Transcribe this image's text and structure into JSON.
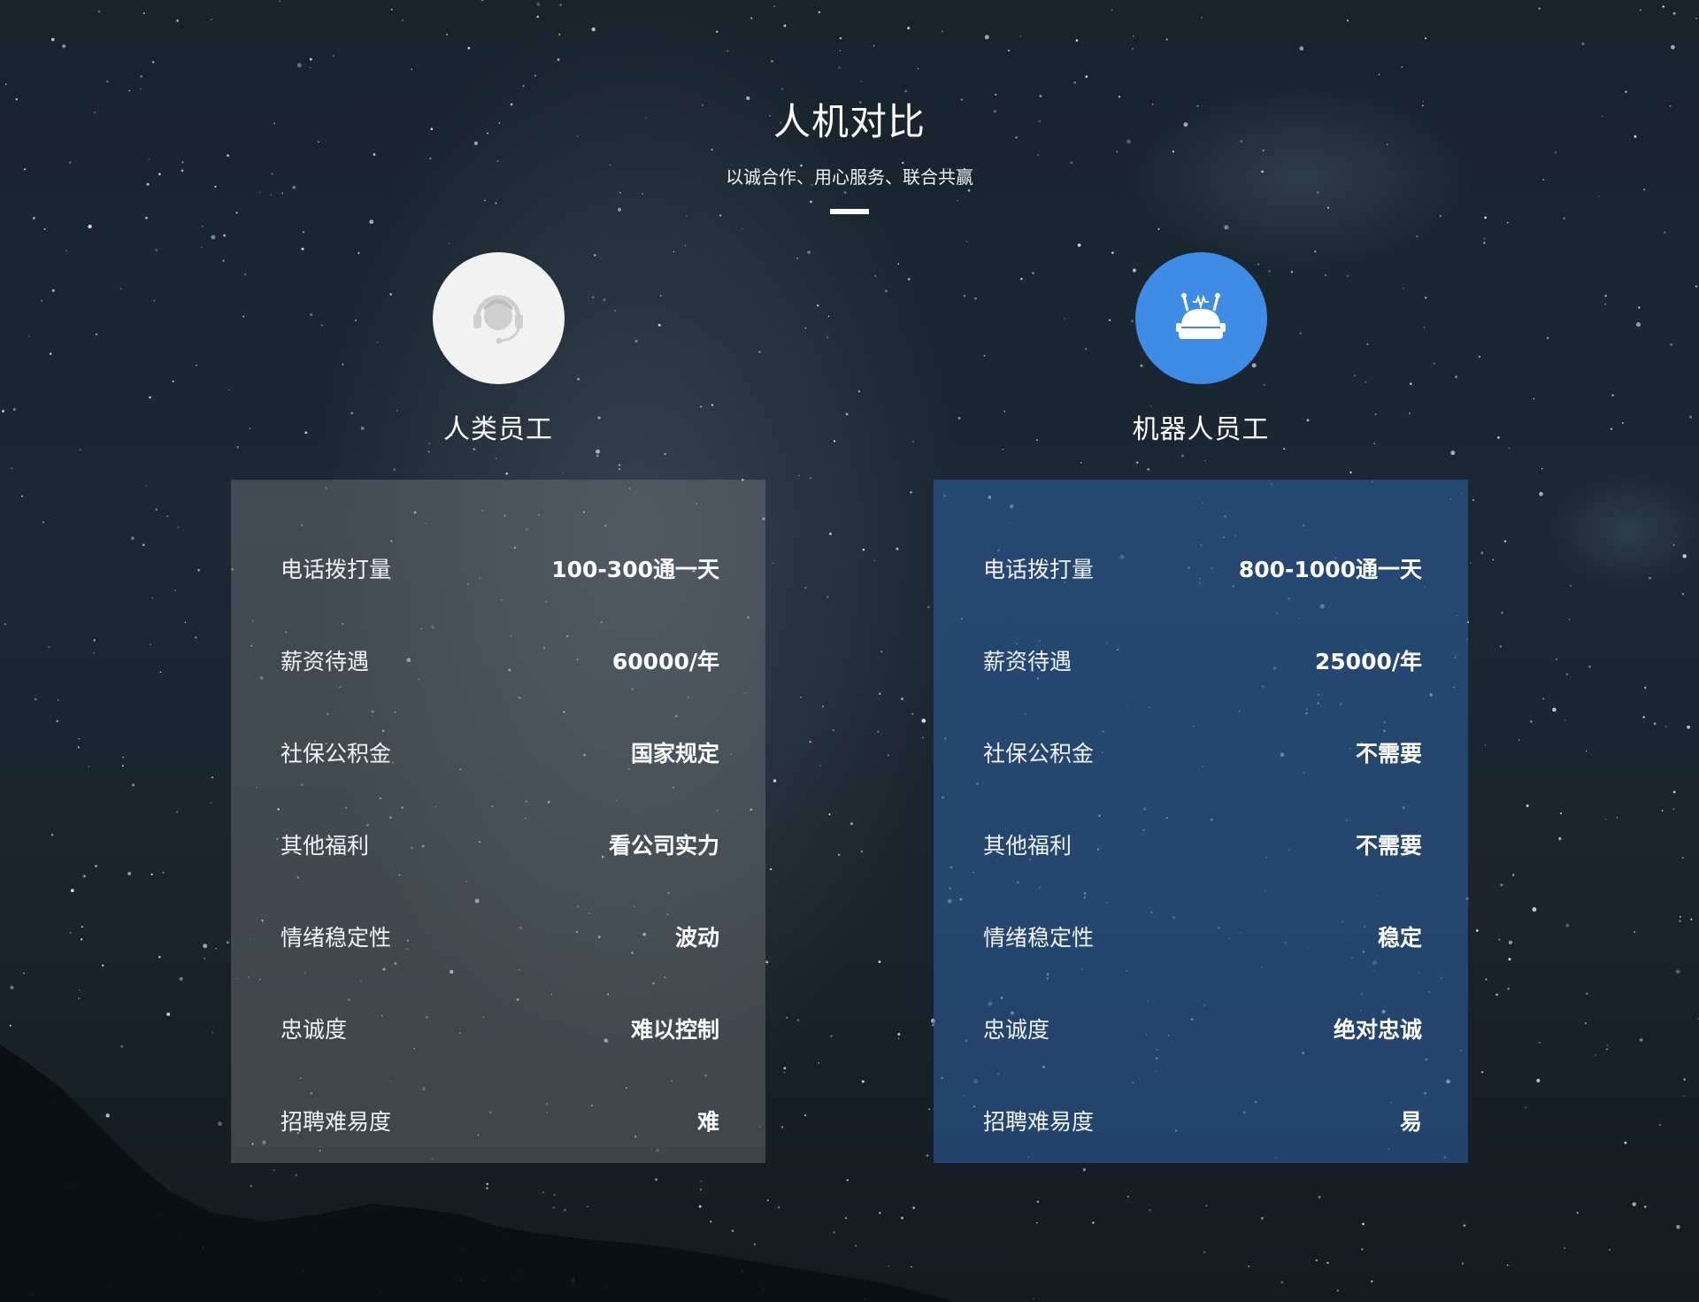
{
  "header": {
    "title": "人机对比",
    "subtitle": "以诚合作、用心服务、联合共赢"
  },
  "human": {
    "title": "人类员工",
    "icon": "headset-agent-icon",
    "avatar_color": "#f2f2f2",
    "rows": [
      {
        "label": "电话拨打量",
        "value": "100-300通一天"
      },
      {
        "label": "薪资待遇",
        "value": "60000/年"
      },
      {
        "label": "社保公积金",
        "value": "国家规定"
      },
      {
        "label": "其他福利",
        "value": "看公司实力"
      },
      {
        "label": "情绪稳定性",
        "value": "波动"
      },
      {
        "label": "忠诚度",
        "value": "难以控制"
      },
      {
        "label": "招聘难易度",
        "value": "难"
      }
    ]
  },
  "robot": {
    "title": "机器人员工",
    "icon": "robot-icon",
    "avatar_color": "#3f8ce6",
    "rows": [
      {
        "label": "电话拨打量",
        "value": "800-1000通一天"
      },
      {
        "label": "薪资待遇",
        "value": "25000/年"
      },
      {
        "label": "社保公积金",
        "value": "不需要"
      },
      {
        "label": "其他福利",
        "value": "不需要"
      },
      {
        "label": "情绪稳定性",
        "value": "稳定"
      },
      {
        "label": "忠诚度",
        "value": "绝对忠诚"
      },
      {
        "label": "招聘难易度",
        "value": "易"
      }
    ]
  }
}
